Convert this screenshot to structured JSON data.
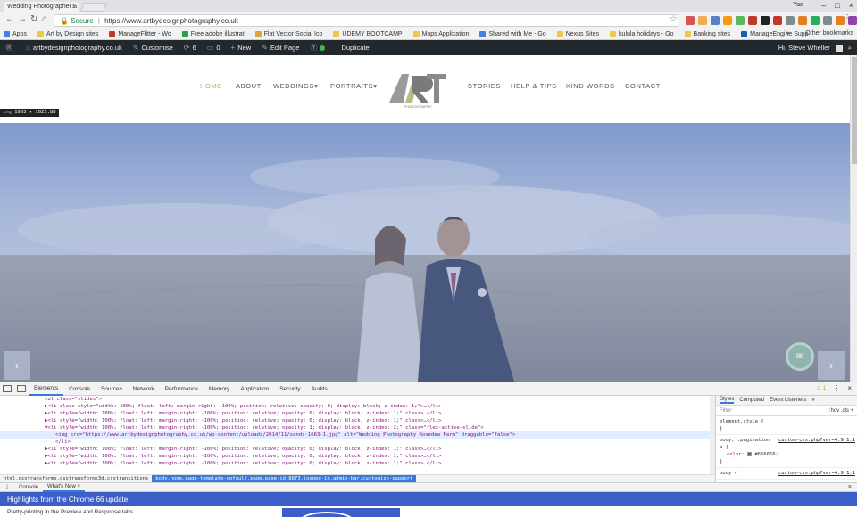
{
  "browser": {
    "tab_title": "Wedding Photographer S",
    "profile_label": "Yaa",
    "url_secure": "Secure",
    "url": "https://www.artbydesignphotography.co.uk"
  },
  "bookmarks": {
    "items": [
      {
        "label": "Apps",
        "color": "#4a7ee6"
      },
      {
        "label": "Art by Design sites",
        "color": "#f0c94a"
      },
      {
        "label": "ManageFlitter - Wo",
        "color": "#c0392b"
      },
      {
        "label": "Free adobe illustrat",
        "color": "#2e9e44"
      },
      {
        "label": "Flat Vector Social Ico",
        "color": "#d6a640"
      },
      {
        "label": "UDEMY BOOTCAMP",
        "color": "#f0c94a"
      },
      {
        "label": "Maps Application",
        "color": "#f0c94a"
      },
      {
        "label": "Shared with Me - Go",
        "color": "#4a7ee6"
      },
      {
        "label": "Nexus Sites",
        "color": "#f0c94a"
      },
      {
        "label": "kulula holidays - Go",
        "color": "#f0c94a"
      },
      {
        "label": "Banking sites",
        "color": "#f0c94a"
      },
      {
        "label": "ManageEngine Supp",
        "color": "#1b5fb5"
      }
    ],
    "more": "»",
    "other": "Other bookmarks"
  },
  "wp_admin": {
    "site_name": "artbydesignphotography.co.uk",
    "customise": "Customise",
    "updates": "6",
    "comments": "0",
    "new": "New",
    "edit_page": "Edit Page",
    "duplicate": "Duplicate",
    "greeting": "Hi, Steve Wheller"
  },
  "site": {
    "nav": [
      "HOME",
      "ABOUT",
      "WEDDINGS",
      "PORTRAITS",
      "STORIES",
      "HELP & TIPS",
      "KIND WORDS",
      "CONTACT"
    ],
    "logo_text": "ART",
    "logo_sub": "PHOTOGRAPHY",
    "img_tag_name": "img",
    "img_tag_size": "1903 × 1025.88",
    "prev": "‹",
    "next": "›"
  },
  "devtools": {
    "tabs": [
      "Elements",
      "Console",
      "Sources",
      "Network",
      "Performance",
      "Memory",
      "Application",
      "Security",
      "Audits"
    ],
    "warning_count": "1",
    "elements_lines": [
      {
        "text": "<ul class=\"slides\">",
        "indent": 0,
        "selected": false
      },
      {
        "text": "▶<li class style=\"width: 100%; float: left; margin-right: -100%; position: relative; opacity: 0; display: block; z-index: 1;\">…</li>",
        "indent": 0,
        "selected": false
      },
      {
        "text": "▶<li style=\"width: 100%; float: left; margin-right: -100%; position: relative; opacity: 0; display: block; z-index: 1;\" class>…</li>",
        "indent": 0,
        "selected": false
      },
      {
        "text": "▶<li style=\"width: 100%; float: left; margin-right: -100%; position: relative; opacity: 0; display: block; z-index: 1;\" class>…</li>",
        "indent": 0,
        "selected": false
      },
      {
        "text": "▼<li style=\"width: 100%; float: left; margin-right: -100%; position: relative; opacity: 1; display: block; z-index: 2;\" class=\"flex-active-slide\">",
        "indent": 0,
        "selected": false
      },
      {
        "text": "<img src=\"https://www.artbydesignphotography.co.uk/wp-content/uploads/2014/11/sands-1663-1.jpg\" alt=\"Wedding Photography Rosedew Farm\" draggable=\"false\">",
        "indent": 1,
        "selected": true
      },
      {
        "text": "</li>",
        "indent": 1,
        "selected": false
      },
      {
        "text": "▶<li style=\"width: 100%; float: left; margin-right: -100%; position: relative; opacity: 0; display: block; z-index: 1;\" class>…</li>",
        "indent": 0,
        "selected": false
      },
      {
        "text": "▶<li style=\"width: 100%; float: left; margin-right: -100%; position: relative; opacity: 0; display: block; z-index: 1;\" class>…</li>",
        "indent": 0,
        "selected": false
      },
      {
        "text": "▶<li style=\"width: 100%; float: left; margin-right: -100%; position: relative; opacity: 0; display: block; z-index: 1;\" class>…</li>",
        "indent": 0,
        "selected": false
      }
    ],
    "breadcrumb_1": "html.csstransforms.csstransforms3d.csstransitions",
    "breadcrumb_2": "body.home.page-template-default.page.page-id-8873.logged-in.admin-bar.customize-support",
    "styles_tabs": [
      "Styles",
      "Computed",
      "Event Listeners"
    ],
    "styles_more": "»",
    "filter_placeholder": "Filter",
    "filter_opts": ":hov  .cls  +",
    "rules": [
      {
        "selector": "element.style {",
        "body": "}",
        "link": ""
      },
      {
        "selector": "body, .pagination",
        "body": "a {",
        "prop": "color:",
        "value": "#666666;",
        "close": "}",
        "link": "custom-css.php?ver=4.9.1:1"
      },
      {
        "selector": "body {",
        "body": "",
        "link": "custom-css.php?ver=4.9.1:1"
      }
    ],
    "drawer_tabs": [
      "Console",
      "What's New ×"
    ],
    "whats_new_title": "Highlights from the Chrome 66 update",
    "whats_new_item": "Pretty-printing in the Preview and Response tabs"
  },
  "colors": {
    "nav_active": "#a8b56b",
    "wp_bar": "#23282d",
    "overlay": "#6f86bd",
    "devtools_accent": "#3879d9",
    "whats_new_bg": "#3d5ec7"
  }
}
